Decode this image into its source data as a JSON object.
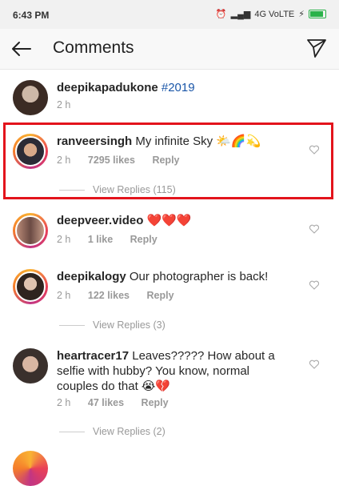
{
  "status_bar": {
    "time": "6:43 PM",
    "network": "4G VoLTE"
  },
  "header": {
    "title": "Comments",
    "back_icon": "arrow-left-icon",
    "send_icon": "paper-plane-icon"
  },
  "comments": [
    {
      "username": "deepikapadukone",
      "text": "#2019",
      "time": "2 h"
    },
    {
      "username": "ranveersingh",
      "text": "My infinite Sky 🌤️🌈💫",
      "time": "2 h",
      "likes": "7295 likes",
      "reply": "Reply",
      "view_replies": "View Replies (115)"
    },
    {
      "username": "deepveer.video",
      "text": "❤️❤️❤️",
      "time": "2 h",
      "likes": "1 like",
      "reply": "Reply"
    },
    {
      "username": "deepikalogy",
      "text": "Our photographer is back!",
      "time": "2 h",
      "likes": "122 likes",
      "reply": "Reply",
      "view_replies": "View Replies (3)"
    },
    {
      "username": "heartracer17",
      "text": "Leaves????? How about a selfie with hubby? You know, normal couples do that 😭💔",
      "time": "2 h",
      "likes": "47 likes",
      "reply": "Reply",
      "view_replies": "View Replies (2)"
    }
  ],
  "colors": {
    "highlight": "#e3141c",
    "hashtag": "#1a56a8"
  }
}
